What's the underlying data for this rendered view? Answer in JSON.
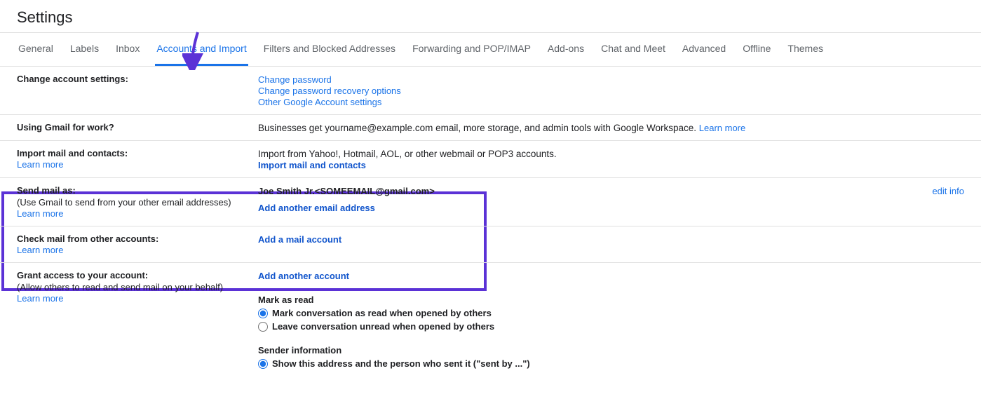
{
  "pageTitle": "Settings",
  "tabs": {
    "general": "General",
    "labels": "Labels",
    "inbox": "Inbox",
    "accounts": "Accounts and Import",
    "filters": "Filters and Blocked Addresses",
    "forwarding": "Forwarding and POP/IMAP",
    "addons": "Add-ons",
    "chat": "Chat and Meet",
    "advanced": "Advanced",
    "offline": "Offline",
    "themes": "Themes"
  },
  "changeAccount": {
    "label": "Change account settings:",
    "changePassword": "Change password",
    "recoveryOptions": "Change password recovery options",
    "otherSettings": "Other Google Account settings"
  },
  "work": {
    "label": "Using Gmail for work?",
    "text": "Businesses get yourname@example.com email, more storage, and admin tools with Google Workspace. ",
    "learn": "Learn more"
  },
  "import": {
    "label": "Import mail and contacts:",
    "learn": "Learn more",
    "text": "Import from Yahoo!, Hotmail, AOL, or other webmail or POP3 accounts.",
    "action": "Import mail and contacts"
  },
  "sendAs": {
    "label": "Send mail as:",
    "sub": "(Use Gmail to send from your other email addresses)",
    "learn": "Learn more",
    "identity": "Joe Smith Jr.<SOMEEMAIL@gmail.com>",
    "action": "Add another email address",
    "edit": "edit info"
  },
  "checkMail": {
    "label": "Check mail from other accounts:",
    "learn": "Learn more",
    "action": "Add a mail account"
  },
  "grant": {
    "label": "Grant access to your account:",
    "sub": "(Allow others to read and send mail on your behalf)",
    "learn": "Learn more",
    "action": "Add another account",
    "markRead": "Mark as read",
    "opt1": "Mark conversation as read when opened by others",
    "opt2": "Leave conversation unread when opened by others",
    "senderInfo": "Sender information",
    "opt3": "Show this address and the person who sent it (\"sent by ...\")"
  }
}
